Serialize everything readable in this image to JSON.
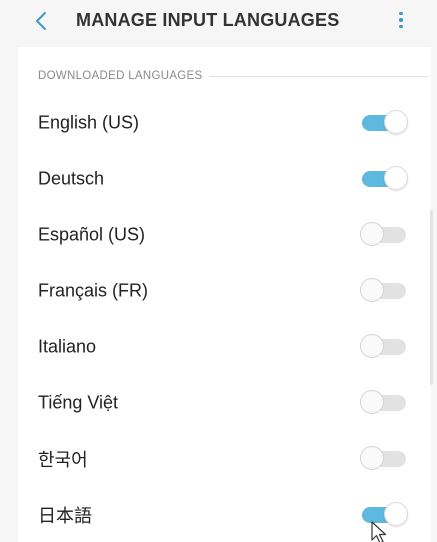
{
  "app_bar": {
    "title": "MANAGE INPUT LANGUAGES",
    "back_icon": "chevron-left-icon",
    "more_icon": "more-vertical-icon"
  },
  "section": {
    "header": "DOWNLOADED LANGUAGES"
  },
  "languages": [
    {
      "label": "English (US)",
      "enabled": true
    },
    {
      "label": "Deutsch",
      "enabled": true
    },
    {
      "label": "Español (US)",
      "enabled": false
    },
    {
      "label": "Français (FR)",
      "enabled": false
    },
    {
      "label": "Italiano",
      "enabled": false
    },
    {
      "label": "Tiếng Việt",
      "enabled": false
    },
    {
      "label": "한국어",
      "enabled": false
    },
    {
      "label": "日本語",
      "enabled": true
    }
  ],
  "colors": {
    "accent": "#3f9bc6",
    "switch_on_track": "#5fb8e0",
    "switch_off_track": "#e2e2e2",
    "app_bar_bg": "#f6f6f6"
  }
}
